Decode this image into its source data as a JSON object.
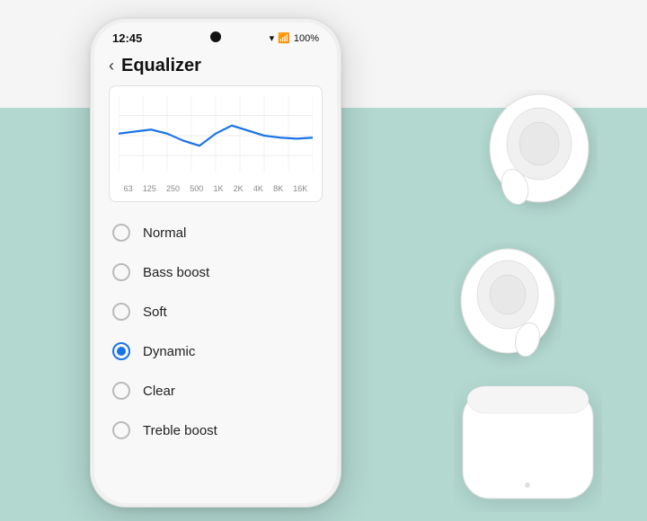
{
  "background": {
    "top_color": "#f5f5f5",
    "bottom_color": "#b2d8d0"
  },
  "status_bar": {
    "time": "12:45",
    "battery": "100%",
    "signal": "WiFi + bars"
  },
  "header": {
    "back_label": "‹",
    "title": "Equalizer"
  },
  "eq_chart": {
    "labels": [
      "63",
      "125",
      "250",
      "500",
      "1K",
      "2K",
      "4K",
      "8K",
      "16K"
    ]
  },
  "options": [
    {
      "id": "normal",
      "label": "Normal",
      "selected": false
    },
    {
      "id": "bass-boost",
      "label": "Bass boost",
      "selected": false
    },
    {
      "id": "soft",
      "label": "Soft",
      "selected": false
    },
    {
      "id": "dynamic",
      "label": "Dynamic",
      "selected": true
    },
    {
      "id": "clear",
      "label": "Clear",
      "selected": false
    },
    {
      "id": "treble-boost",
      "label": "Treble boost",
      "selected": false
    }
  ]
}
